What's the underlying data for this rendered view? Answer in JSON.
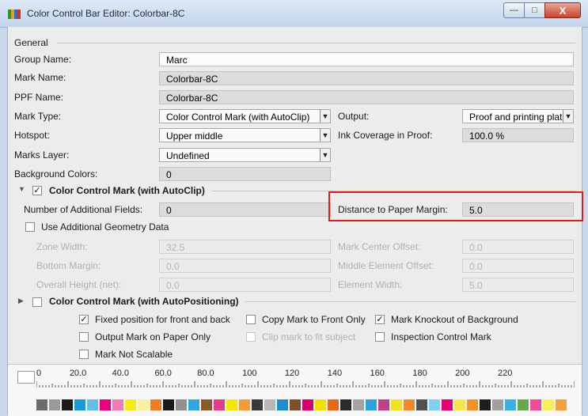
{
  "window": {
    "title": "Color Control Bar Editor: Colorbar-8C",
    "close_label": "X",
    "min_label": "—",
    "max_label": "□"
  },
  "general": {
    "section_title": "General",
    "group_name_label": "Group Name:",
    "group_name_value": "Marc",
    "mark_name_label": "Mark Name:",
    "mark_name_value": "Colorbar-8C",
    "ppf_name_label": "PPF Name:",
    "ppf_name_value": "Colorbar-8C",
    "mark_type_label": "Mark Type:",
    "mark_type_value": "Color Control Mark (with AutoClip)",
    "output_label": "Output:",
    "output_value": "Proof and printing plate",
    "hotspot_label": "Hotspot:",
    "hotspot_value": "Upper middle",
    "ink_coverage_label": "Ink Coverage in Proof:",
    "ink_coverage_value": "100.0 %",
    "marks_layer_label": "Marks Layer:",
    "marks_layer_value": "Undefined",
    "background_colors_label": "Background Colors:",
    "background_colors_value": "0"
  },
  "autoclip": {
    "section_title": "Color Control Mark (with AutoClip)",
    "enabled": true,
    "additional_fields_label": "Number of Additional Fields:",
    "additional_fields_value": "0",
    "distance_label": "Distance to Paper Margin:",
    "distance_value": "5.0",
    "use_geometry_label": "Use Additional Geometry Data",
    "use_geometry_checked": false,
    "zone_width_label": "Zone Width:",
    "zone_width_value": "32.5",
    "mark_center_offset_label": "Mark Center Offset:",
    "mark_center_offset_value": "0.0",
    "bottom_margin_label": "Bottom Margin:",
    "bottom_margin_value": "0.0",
    "middle_element_offset_label": "Middle Element Offset:",
    "middle_element_offset_value": "0.0",
    "overall_height_label": "Overall Height (net):",
    "overall_height_value": "0.0",
    "element_width_label": "Element Width:",
    "element_width_value": "5.0"
  },
  "autopositioning": {
    "section_title": "Color Control Mark (with AutoPositioning)",
    "enabled": false
  },
  "options": {
    "fixed_position_label": "Fixed position for front and back",
    "fixed_position_checked": true,
    "copy_to_front_label": "Copy Mark to Front Only",
    "copy_to_front_checked": false,
    "knockout_label": "Mark Knockout of Background",
    "knockout_checked": true,
    "output_on_paper_label": "Output Mark on Paper Only",
    "output_on_paper_checked": false,
    "clip_to_subject_label": "Clip mark to fit subject",
    "clip_to_subject_checked": false,
    "inspection_label": "Inspection Control Mark",
    "inspection_checked": false,
    "not_scalable_label": "Mark Not Scalable",
    "not_scalable_checked": false
  },
  "ruler": {
    "labels": [
      "0",
      "20.0",
      "40.0",
      "60.0",
      "80.0",
      "100",
      "120",
      "140",
      "160",
      "180",
      "200",
      "220"
    ]
  },
  "colorbar": {
    "swatches": [
      "#6b6b6b",
      "#9a9a9a",
      "#1c1c1c",
      "#1b9ad8",
      "#5fc0ea",
      "#e6007e",
      "#f07ab6",
      "#f7ea1a",
      "#f9f19a",
      "#ef7d22",
      "#1a1a1a",
      "#8f8f8f",
      "#2ba8e0",
      "#8a5a2b",
      "#e23c8d",
      "#f6e500",
      "#f49a39",
      "#3a3a3a",
      "#b8b8b8",
      "#1d8fd0",
      "#7d4f2a",
      "#d6006f",
      "#f3de00",
      "#e9671c",
      "#2a2a2a",
      "#a3a3a3",
      "#29a3dc",
      "#c03f8c",
      "#efe21e",
      "#f08a2a",
      "#505050",
      "#7fd0f2",
      "#e5007a",
      "#f6e54f",
      "#f29222",
      "#1e1e1e",
      "#a0a0a0",
      "#3bb0e5",
      "#6aa84f",
      "#ee4d9a",
      "#f8ee5a",
      "#f4a03c"
    ]
  }
}
